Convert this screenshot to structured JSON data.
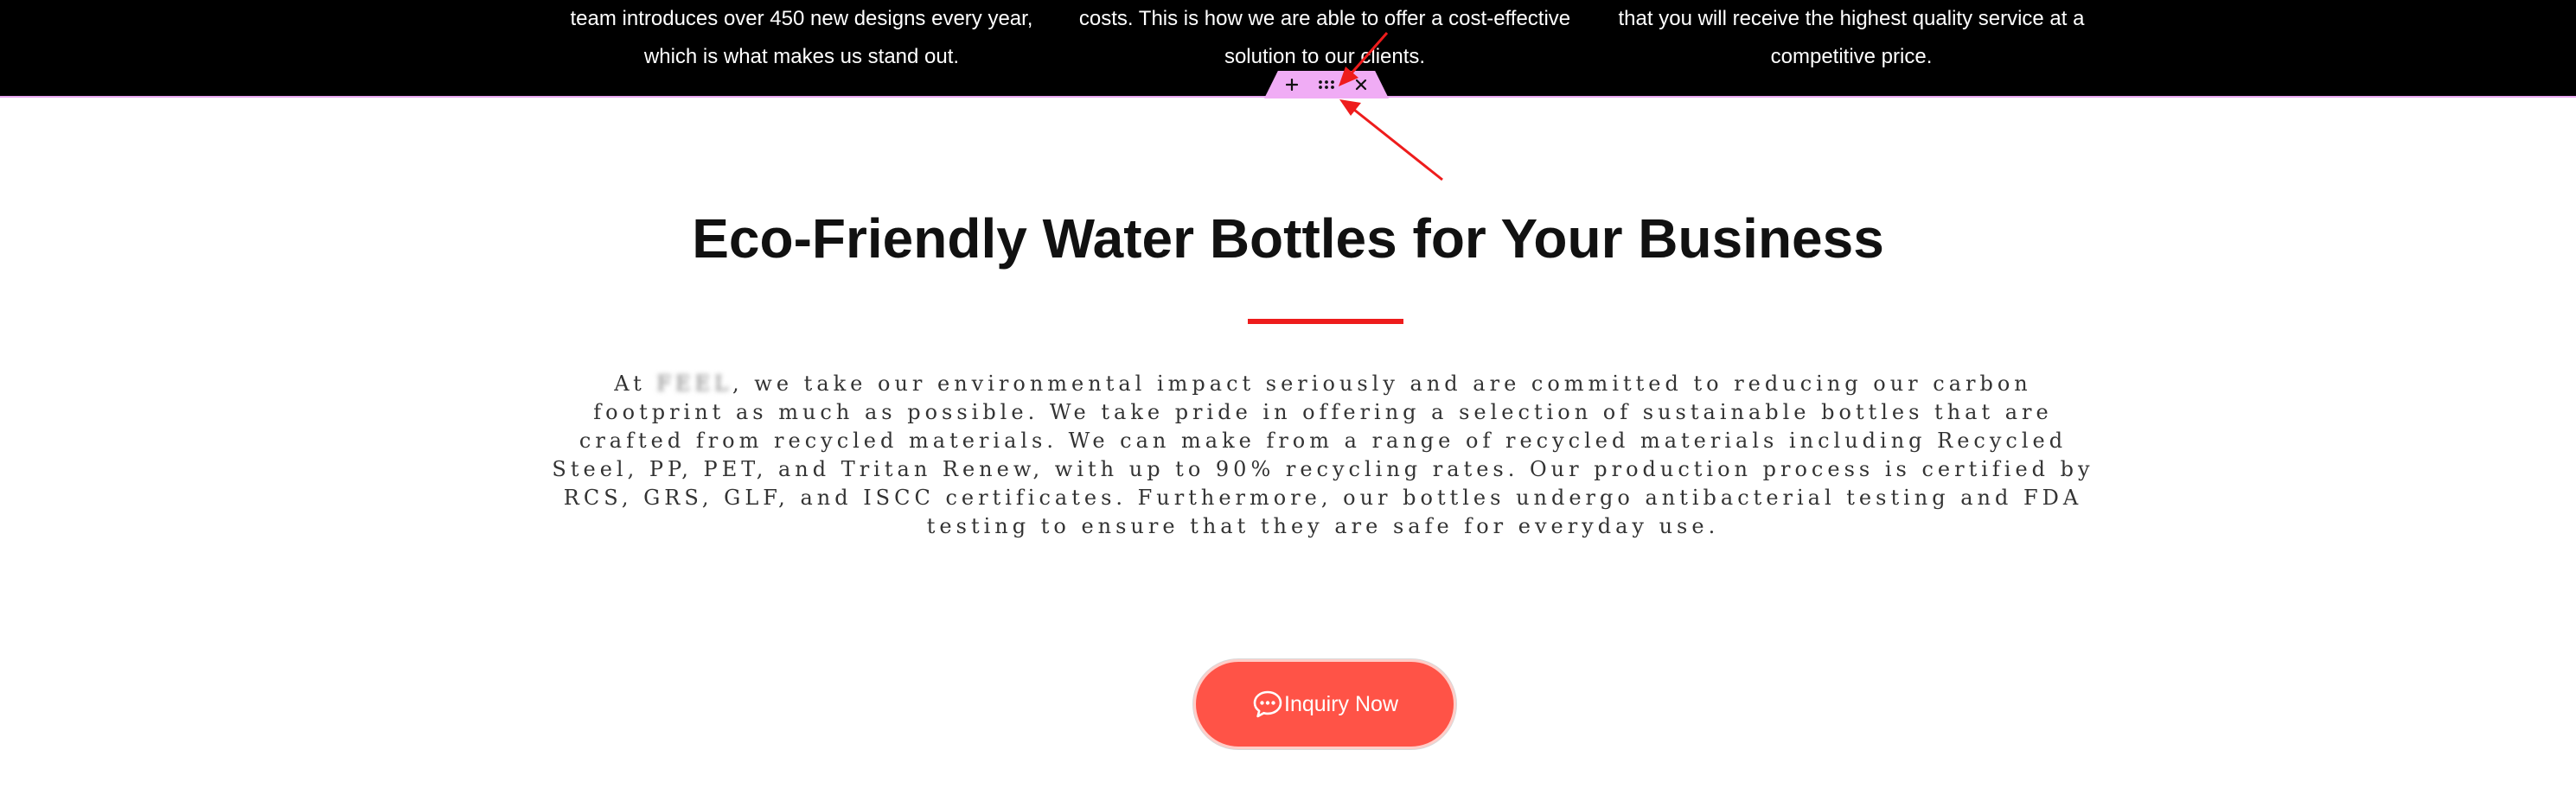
{
  "top_columns": [
    {
      "lines": [
        "team introduces over 450 new designs every year,",
        "which is what makes us stand out."
      ]
    },
    {
      "lines": [
        "costs. This is how we are able to offer a cost-effective",
        "solution to our clients."
      ]
    },
    {
      "lines": [
        "that you will receive the highest quality service at a",
        "competitive price."
      ]
    }
  ],
  "section_toolbar": {
    "add_symbol": "+",
    "close_symbol": "×",
    "icons": [
      "plus-icon",
      "drag-handle-icon",
      "close-icon"
    ]
  },
  "main": {
    "title": "Eco-Friendly Water Bottles for Your Business",
    "description": {
      "prefix": "At ",
      "brand": "FEEL",
      "text": ", we take our environmental impact seriously and are committed to reducing our carbon footprint as much as possible. We take pride in offering a selection of sustainable bottles that are crafted from recycled materials. We can make from a range of recycled materials including Recycled Steel, PP, PET, and Tritan Renew, with up to 90% recycling rates. Our production process is certified by RCS, GRS, GLF, and ISCC certificates. Furthermore, our bottles undergo antibacterial testing and FDA testing to ensure that they are safe for everyday use."
    },
    "cta": {
      "label": "Inquiry Now",
      "icon": "chat-bubble-icon"
    }
  },
  "colors": {
    "top_strip": "#000000",
    "toolbar": "#f0acf5",
    "divider": "#ee1c1c",
    "button": "#ff5347",
    "annotation_arrow": "#ee1c1c"
  }
}
